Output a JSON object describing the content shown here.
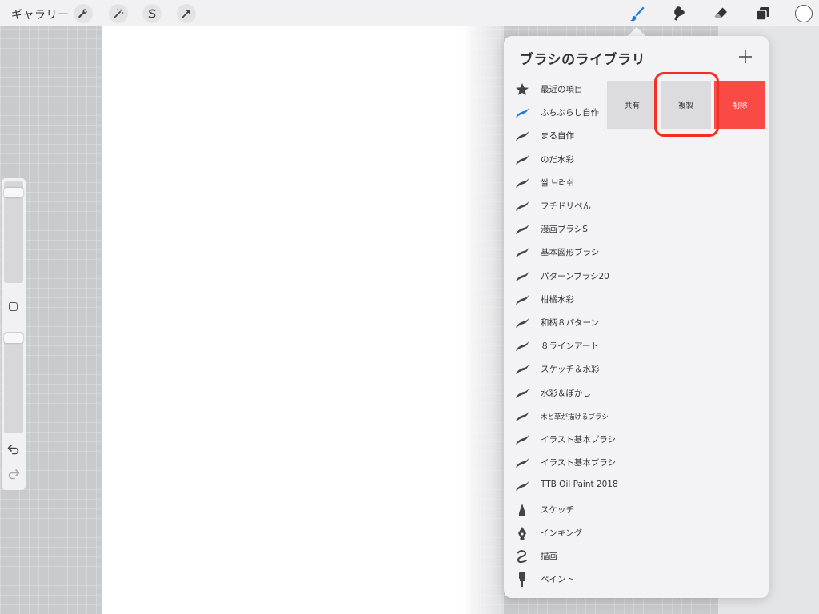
{
  "topbar": {
    "gallery_label": "ギャラリー",
    "left_tools": [
      "wrench-icon",
      "magic-wand-icon",
      "selection-s-icon",
      "transform-arrow-icon"
    ],
    "right_tools": [
      "brush-icon",
      "smudge-icon",
      "eraser-icon",
      "layers-icon"
    ],
    "active_tool": "brush-icon",
    "accent_color": "#1a7ae8",
    "current_color": "#ffffff"
  },
  "library": {
    "title": "ブラシのライブラリ",
    "add_label": "+",
    "items": [
      {
        "label": "最近の項目",
        "icon": "star-icon"
      },
      {
        "label": "ふちぶらし自作",
        "icon": "brush-stroke-icon",
        "selected": true
      },
      {
        "label": "まる自作",
        "icon": "brush-stroke-icon"
      },
      {
        "label": "のだ水彩",
        "icon": "brush-stroke-icon"
      },
      {
        "label": "씰 브러쉬",
        "icon": "brush-stroke-icon"
      },
      {
        "label": "フチドリペん",
        "icon": "brush-stroke-icon"
      },
      {
        "label": "漫画ブラシS",
        "icon": "brush-stroke-icon"
      },
      {
        "label": "基本図形ブラシ",
        "icon": "brush-stroke-icon"
      },
      {
        "label": "パターンブラシ20",
        "icon": "brush-stroke-icon"
      },
      {
        "label": "柑橘水彩",
        "icon": "brush-stroke-icon"
      },
      {
        "label": "和柄８パターン",
        "icon": "brush-stroke-icon"
      },
      {
        "label": "８ラインアート",
        "icon": "brush-stroke-icon"
      },
      {
        "label": "スケッチ＆水彩",
        "icon": "brush-stroke-icon"
      },
      {
        "label": "水彩＆ぼかし",
        "icon": "brush-stroke-icon"
      },
      {
        "label": "木と草が描けるブラシ",
        "icon": "brush-stroke-icon",
        "small": true
      },
      {
        "label": "イラスト基本ブラシ",
        "icon": "brush-stroke-icon"
      },
      {
        "label": "イラスト基本ブラシ",
        "icon": "brush-stroke-icon"
      },
      {
        "label": "TTB Oil Paint 2018",
        "icon": "brush-stroke-icon"
      },
      {
        "label": "スケッチ",
        "icon": "pencil-tip-icon"
      },
      {
        "label": "インキング",
        "icon": "pen-nib-icon"
      },
      {
        "label": "描画",
        "icon": "squiggle-icon"
      },
      {
        "label": "ペイント",
        "icon": "paint-brush-icon"
      }
    ]
  },
  "actions": {
    "share_label": "共有",
    "duplicate_label": "複製",
    "delete_label": "削除",
    "delete_color": "#fa4a45",
    "highlight_color": "#f22f22"
  },
  "sidebar": {
    "size_level": 0.07,
    "opacity_level": 0.05
  }
}
